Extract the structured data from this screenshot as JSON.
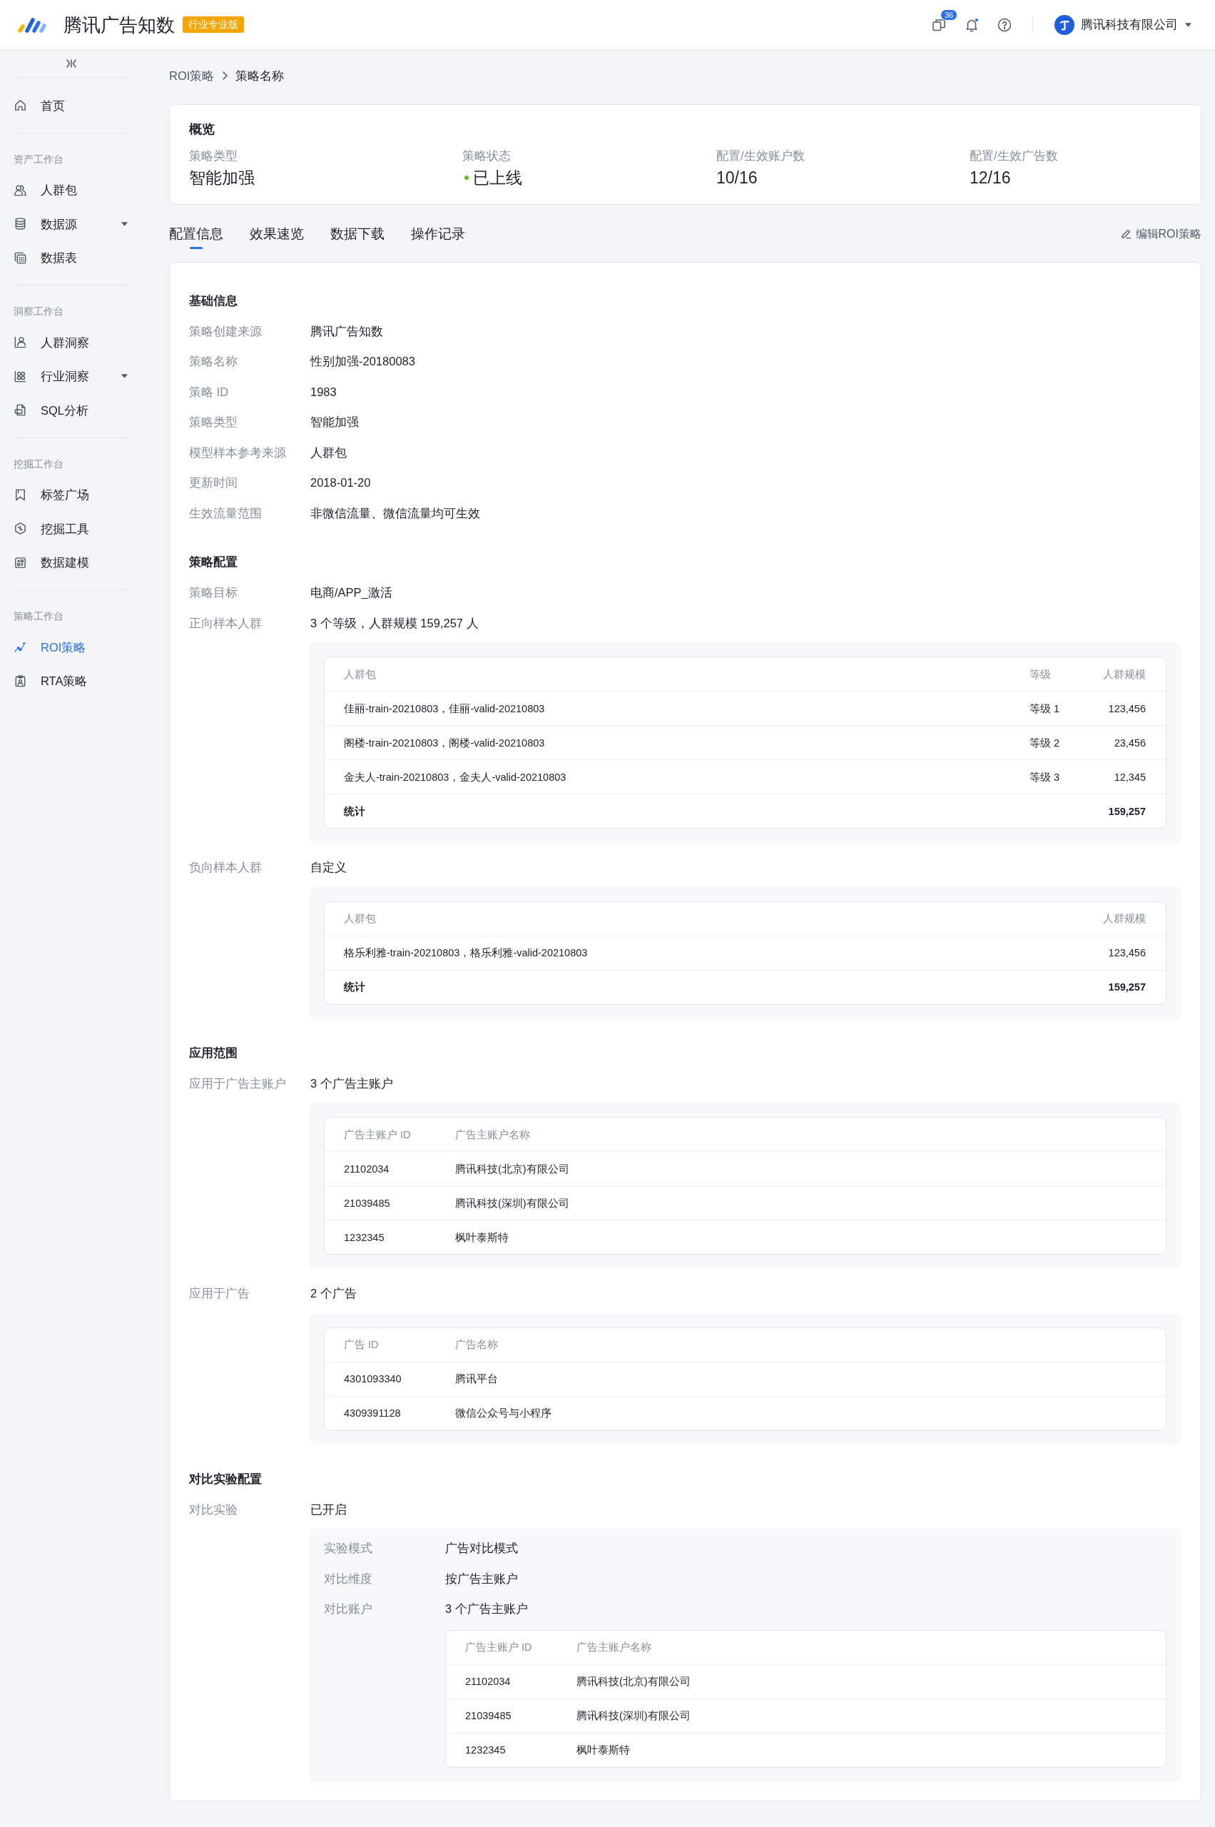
{
  "header": {
    "product_name": "腾讯广告知数",
    "edition": "行业专业版",
    "message_count": "36",
    "unread_notifications": true,
    "account_name": "腾讯科技有限公司"
  },
  "sidebar": {
    "groups": [
      {
        "items": [
          {
            "label": "首页",
            "selected": false,
            "expandable": false
          }
        ]
      },
      {
        "title": "资产工作台",
        "items": [
          {
            "label": "人群包",
            "selected": false,
            "expandable": false
          },
          {
            "label": "数据源",
            "selected": false,
            "expandable": true
          },
          {
            "label": "数据表",
            "selected": false,
            "expandable": false
          }
        ]
      },
      {
        "title": "洞察工作台",
        "items": [
          {
            "label": "人群洞察",
            "selected": false,
            "expandable": false
          },
          {
            "label": "行业洞察",
            "selected": false,
            "expandable": true
          },
          {
            "label": "SQL分析",
            "selected": false,
            "expandable": false
          }
        ]
      },
      {
        "title": "挖掘工作台",
        "items": [
          {
            "label": "标签广场",
            "selected": false,
            "expandable": false
          },
          {
            "label": "挖掘工具",
            "selected": false,
            "expandable": false
          },
          {
            "label": "数据建模",
            "selected": false,
            "expandable": false
          }
        ]
      },
      {
        "title": "策略工作台",
        "items": [
          {
            "label": "ROI策略",
            "selected": true,
            "expandable": false
          },
          {
            "label": "RTA策略",
            "selected": false,
            "expandable": false
          }
        ]
      }
    ]
  },
  "breadcrumb": [
    {
      "label": "ROI策略",
      "current": false
    },
    {
      "label": "策略名称",
      "current": true
    }
  ],
  "overview": {
    "title": "概览",
    "stats": [
      {
        "kind": "text",
        "label": "策略类型",
        "value": "智能加强"
      },
      {
        "kind": "status",
        "label": "策略状态",
        "value": "已上线",
        "color": "#52c41a"
      },
      {
        "kind": "text",
        "label": "配置/生效账户数",
        "value": "10/16"
      },
      {
        "kind": "text",
        "label": "配置/生效广告数",
        "value": "12/16"
      }
    ]
  },
  "tabs": [
    {
      "label": "配置信息",
      "selected": true
    },
    {
      "label": "效果速览",
      "selected": false
    },
    {
      "label": "数据下载",
      "selected": false
    },
    {
      "label": "操作记录",
      "selected": false
    }
  ],
  "edit_action": "编辑ROI策略",
  "config": {
    "sections": [
      {
        "title": "基础信息",
        "fields": [
          {
            "kind": "text",
            "label": "策略创建来源",
            "value": "腾讯广告知数"
          },
          {
            "kind": "text",
            "label": "策略名称",
            "value": "性别加强-20180083"
          },
          {
            "kind": "text",
            "label": "策略 ID",
            "value": "1983"
          },
          {
            "kind": "text",
            "label": "策略类型",
            "value": "智能加强"
          },
          {
            "kind": "text",
            "label": "模型样本参考来源",
            "value": "人群包"
          },
          {
            "kind": "text",
            "label": "更新时间",
            "value": "2018-01-20"
          },
          {
            "kind": "text",
            "label": "生效流量范围",
            "value": "非微信流量、微信流量均可生效"
          }
        ]
      },
      {
        "title": "策略配置",
        "fields": [
          {
            "kind": "text",
            "label": "策略目标",
            "value": "电商/APP_激活"
          },
          {
            "kind": "table",
            "label": "正向样本人群",
            "value": "3 个等级，人群规模 159,257 人",
            "table": {
              "columns": [
                {
                  "label": "人群包",
                  "kind": "name"
                },
                {
                  "label": "等级",
                  "kind": "level"
                },
                {
                  "label": "人群规模",
                  "kind": "amount"
                }
              ],
              "rows": [
                [
                  "佳丽-train-20210803，佳丽-valid-20210803",
                  "等级 1",
                  "123,456"
                ],
                [
                  "阁楼-train-20210803，阁楼-valid-20210803",
                  "等级 2",
                  "23,456"
                ],
                [
                  "金夫人-train-20210803，金夫人-valid-20210803",
                  "等级 3",
                  "12,345"
                ]
              ],
              "summary": {
                "label": "统计",
                "total": "159,257"
              }
            }
          },
          {
            "kind": "table",
            "label": "负向样本人群",
            "value": "自定义",
            "table": {
              "columns": [
                {
                  "label": "人群包",
                  "kind": "name"
                },
                {
                  "label": "人群规模",
                  "kind": "amount"
                }
              ],
              "rows": [
                [
                  "格乐利雅-train-20210803，格乐利雅-valid-20210803",
                  "123,456"
                ]
              ],
              "summary": {
                "label": "统计",
                "total": "159,257"
              }
            }
          }
        ]
      },
      {
        "title": "应用范围",
        "fields": [
          {
            "kind": "table",
            "label": "应用于广告主账户",
            "value": "3 个广告主账户",
            "table": {
              "columns": [
                {
                  "label": "广告主账户 ID",
                  "kind": "id"
                },
                {
                  "label": "广告主账户名称",
                  "kind": "name"
                }
              ],
              "rows": [
                [
                  "21102034",
                  "腾讯科技(北京)有限公司"
                ],
                [
                  "21039485",
                  "腾讯科技(深圳)有限公司"
                ],
                [
                  "1232345",
                  "枫叶泰斯特"
                ]
              ]
            }
          },
          {
            "kind": "table",
            "label": "应用于广告",
            "value": "2 个广告",
            "table": {
              "columns": [
                {
                  "label": "广告 ID",
                  "kind": "id"
                },
                {
                  "label": "广告名称",
                  "kind": "name"
                }
              ],
              "rows": [
                [
                  "4301093340",
                  "腾讯平台"
                ],
                [
                  "4309391128",
                  "微信公众号与小程序"
                ]
              ]
            }
          }
        ]
      },
      {
        "title": "对比实验配置",
        "fields": [
          {
            "kind": "group",
            "label": "对比实验",
            "value": "已开启",
            "details": [
              {
                "kind": "text",
                "label": "实验模式",
                "value": "广告对比模式"
              },
              {
                "kind": "text",
                "label": "对比维度",
                "value": "按广告主账户"
              },
              {
                "kind": "table",
                "label": "对比账户",
                "value": "3 个广告主账户",
                "table": {
                  "columns": [
                    {
                      "label": "广告主账户 ID",
                      "kind": "id"
                    },
                    {
                      "label": "广告主账户名称",
                      "kind": "name"
                    }
                  ],
                  "rows": [
                    [
                      "21102034",
                      "腾讯科技(北京)有限公司"
                    ],
                    [
                      "21039485",
                      "腾讯科技(深圳)有限公司"
                    ],
                    [
                      "1232345",
                      "枫叶泰斯特"
                    ]
                  ]
                }
              }
            ]
          }
        ]
      }
    ]
  }
}
